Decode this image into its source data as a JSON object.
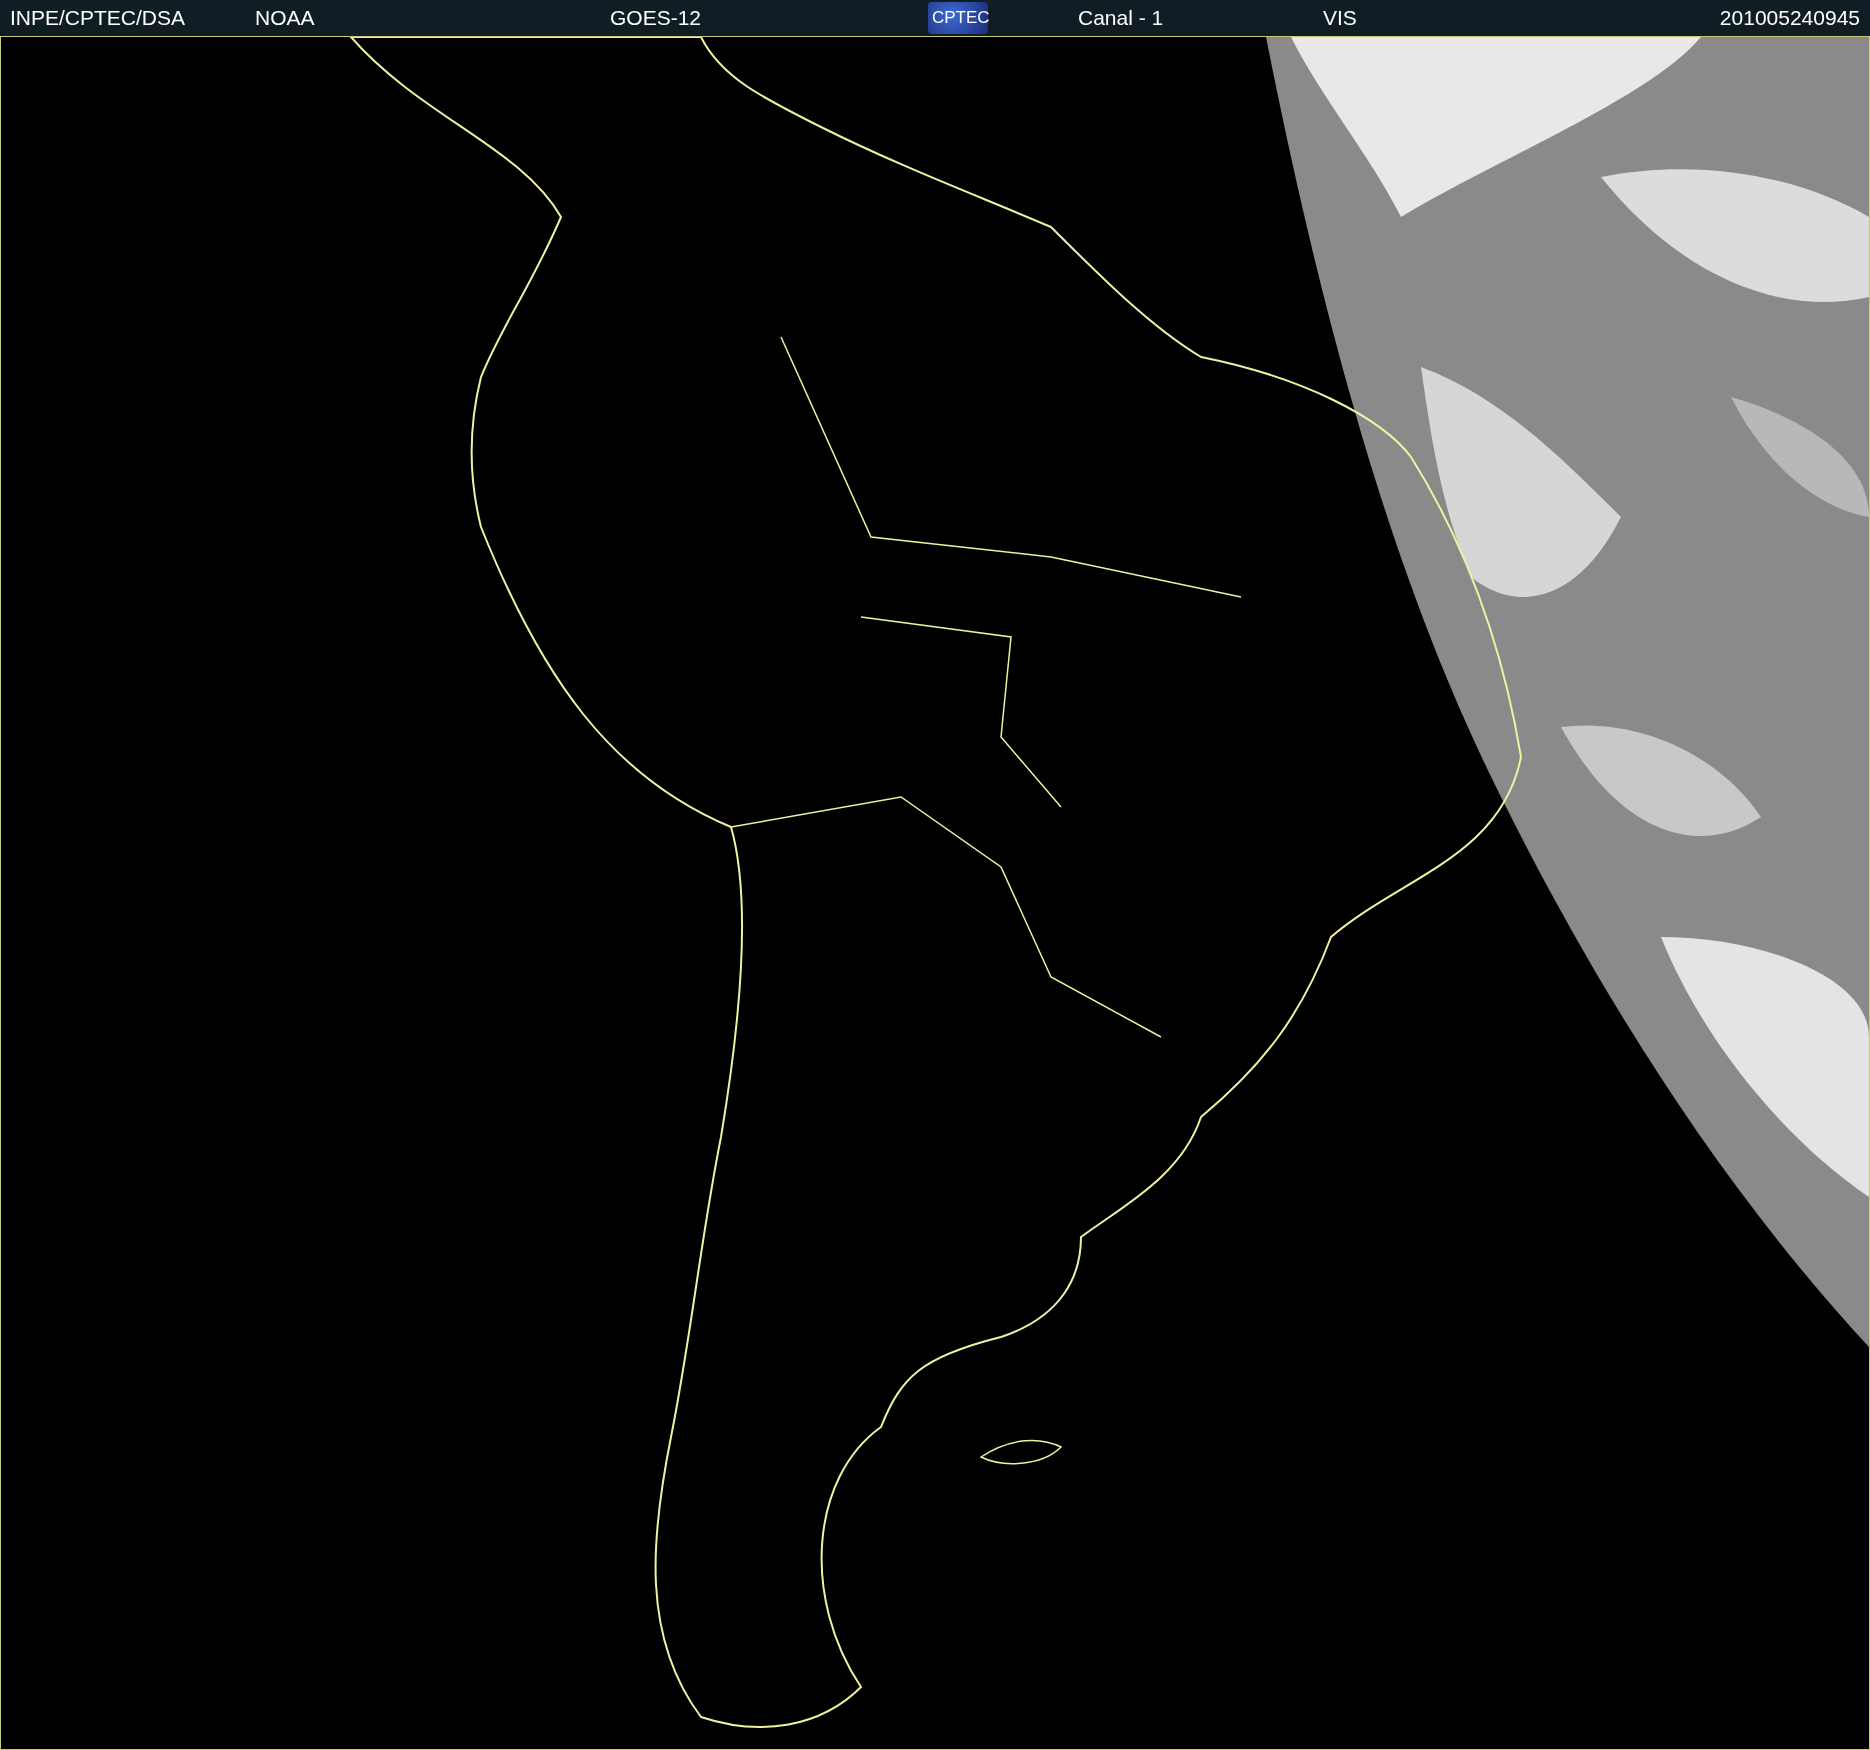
{
  "header": {
    "items": [
      {
        "kind": "text",
        "text": "INPE/CPTEC/DSA"
      },
      {
        "kind": "text",
        "text": "NOAA"
      },
      {
        "kind": "text",
        "text": "GOES-12"
      },
      {
        "kind": "logo",
        "text": "CPTEC"
      },
      {
        "kind": "text",
        "text": "Canal - 1"
      },
      {
        "kind": "text",
        "text": "VIS"
      },
      {
        "kind": "text",
        "text": "201005240945"
      }
    ]
  }
}
